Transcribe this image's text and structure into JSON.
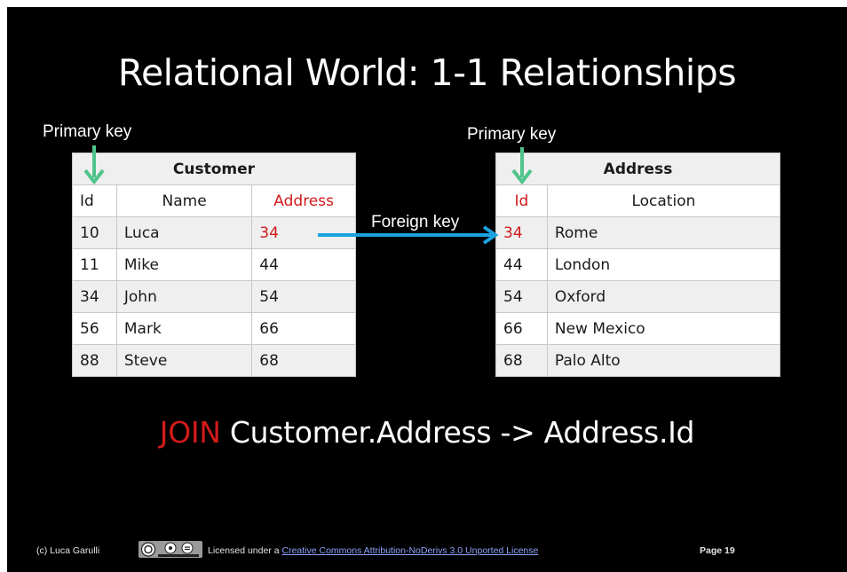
{
  "slide": {
    "title": "Relational World: 1-1 Relationships"
  },
  "labels": {
    "primary_key_left": "Primary key",
    "primary_key_right": "Primary key",
    "foreign_key": "Foreign key"
  },
  "customer_table": {
    "title": "Customer",
    "headers": [
      "Id",
      "Name",
      "Address"
    ],
    "rows": [
      [
        "10",
        "Luca",
        "34"
      ],
      [
        "11",
        "Mike",
        "44"
      ],
      [
        "34",
        "John",
        "54"
      ],
      [
        "56",
        "Mark",
        "66"
      ],
      [
        "88",
        "Steve",
        "68"
      ]
    ]
  },
  "address_table": {
    "title": "Address",
    "headers": [
      "Id",
      "Location"
    ],
    "rows": [
      [
        "34",
        "Rome"
      ],
      [
        "44",
        "London"
      ],
      [
        "54",
        "Oxford"
      ],
      [
        "66",
        "New Mexico"
      ],
      [
        "68",
        "Palo Alto"
      ]
    ]
  },
  "join": {
    "keyword": "JOIN",
    "expression": "Customer.Address -> Address.Id"
  },
  "footer": {
    "author": "(c) Luca Garulli",
    "license_prefix": "Licensed under a",
    "license_link": "Creative Commons Attribution-NoDerivs 3.0 Unported License",
    "page": "Page 19"
  },
  "colors": {
    "background": "#000000",
    "highlight_red": "#d21a1a",
    "primary_key_arrow": "#4fc48a",
    "foreign_key_arrow": "#1aa3e0"
  },
  "icons": {
    "primary_key_arrow": "arrow-down-icon",
    "foreign_key_arrow": "arrow-right-icon",
    "license_badge": "creative-commons-icon"
  }
}
